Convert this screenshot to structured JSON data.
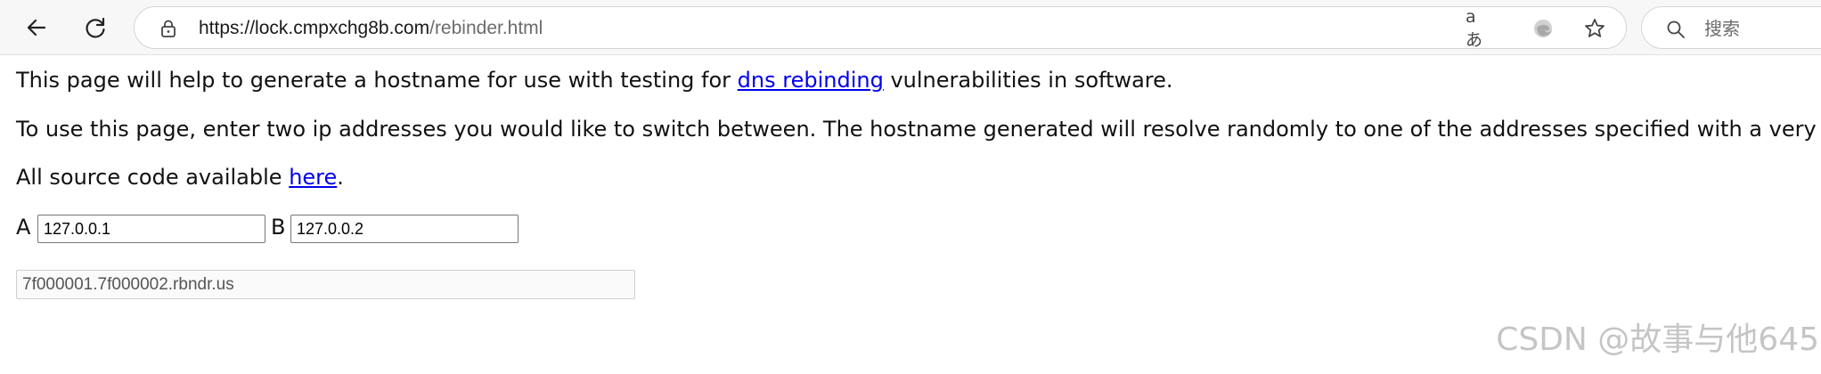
{
  "browser": {
    "url": {
      "host": "https://lock.cmpxchg8b.com",
      "path": "/rebinder.html"
    },
    "translate_glyph": "aあ",
    "search": {
      "placeholder": "搜索"
    },
    "icons": {
      "back": "arrow-left-icon",
      "refresh": "refresh-icon",
      "lock": "lock-icon",
      "translate": "translate-icon",
      "edge": "edge-browser-icon",
      "favorite": "star-icon",
      "search": "magnifier-icon"
    }
  },
  "page": {
    "intro": {
      "before": "This page will help to generate a hostname for use with testing for ",
      "link": "dns rebinding",
      "after": " vulnerabilities in software."
    },
    "instructions": "To use this page, enter two ip addresses you would like to switch between. The hostname generated will resolve randomly to one of the addresses specified with a very low ttl.",
    "source": {
      "before": "All source code available ",
      "link": "here",
      "after": "."
    },
    "form": {
      "label_a": "A",
      "value_a": "127.0.0.1",
      "label_b": "B",
      "value_b": "127.0.0.2"
    },
    "result": "7f000001.7f000002.rbndr.us"
  },
  "watermark": "CSDN @故事与他645",
  "colors": {
    "link": "#0000ee",
    "toolbar_bg": "#f7f7f7",
    "text": "#111111"
  }
}
